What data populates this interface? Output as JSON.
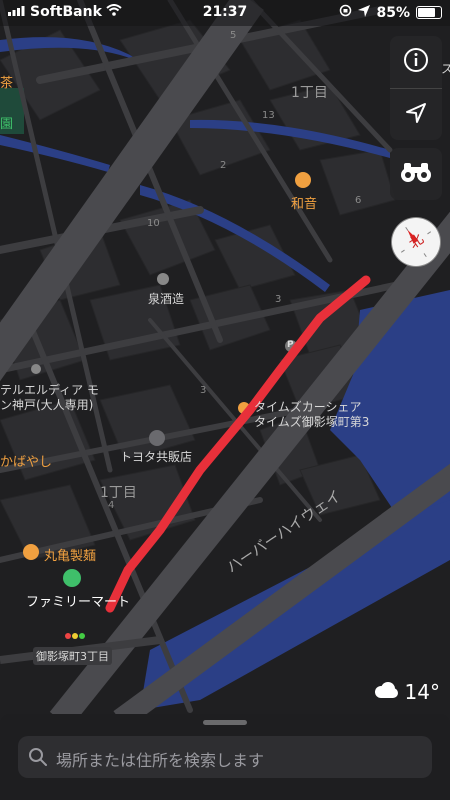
{
  "status_bar": {
    "carrier": "SoftBank",
    "time": "21:37",
    "battery": "85%",
    "battery_level": 0.85
  },
  "map": {
    "labels": {
      "chome_top": "1丁目",
      "chome_mid": "1丁目",
      "waon": "和音",
      "izumi_shuzo": "泉酒造",
      "times_car_share": "タイムズカーシェア",
      "times_mikage": "タイムズ御影塚町第3",
      "toyota": "トヨタ共販店",
      "hotel_line1": "テルエルディア モ",
      "hotel_line2": "ン神戸(大人専用)",
      "kabayashi": "かばやし",
      "marugame": "丸亀製麺",
      "familymart": "ファミリーマート",
      "intersection": "御影塚町3丁目",
      "highway": "ハーバーハイウェイ",
      "edge_left": "茶",
      "edge_left2": "園",
      "edge_right": "ス",
      "road_num_10": "10",
      "road_num_3a": "3",
      "road_num_3b": "3",
      "road_num_4": "4",
      "road_num_2": "2",
      "road_num_13": "13",
      "road_num_6": "6",
      "road_num_5": "5",
      "parking": "P"
    },
    "route_color": "#e8303a",
    "water_color": "#2b3f86",
    "poi_color": "#f0a040",
    "land_color": "#1f1f21",
    "block_color": "#2d2d30"
  },
  "controls": {
    "info_icon": "info-icon",
    "location_icon": "location-arrow-icon",
    "lookaround_icon": "binoculars-icon",
    "compass_label": "北"
  },
  "weather": {
    "temperature": "14°",
    "icon": "cloud-icon"
  },
  "search": {
    "placeholder": "場所または住所を検索します"
  }
}
